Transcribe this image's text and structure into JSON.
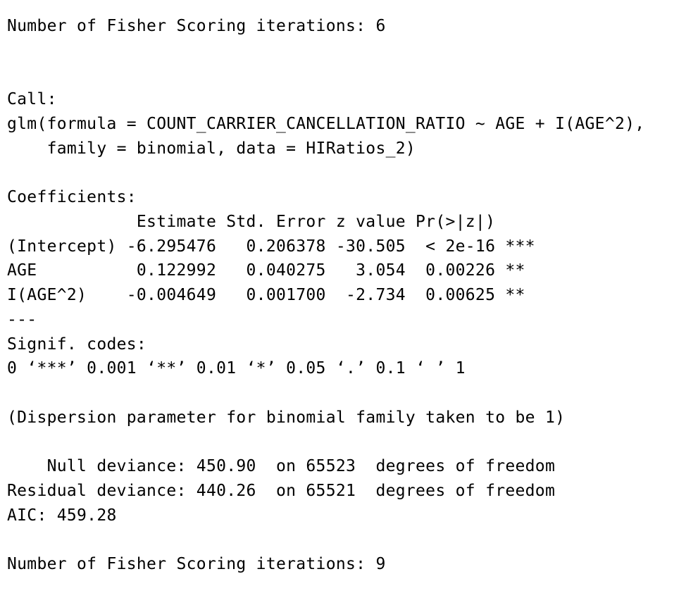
{
  "console": {
    "lines": [
      "Number of Fisher Scoring iterations: 6",
      "Call:",
      "glm(formula = COUNT_CARRIER_CANCELLATION_RATIO ~ AGE + I(AGE^2),",
      "    family = binomial, data = HIRatios_2)",
      "Coefficients:",
      "             Estimate Std. Error z value Pr(>|z|)    ",
      "(Intercept) -6.295476   0.206378 -30.505  < 2e-16 ***",
      "AGE          0.122992   0.040275   3.054  0.00226 ** ",
      "I(AGE^2)    -0.004649   0.001700  -2.734  0.00625 ** ",
      "---",
      "Signif. codes:",
      "0 ‘***’ 0.001 ‘**’ 0.01 ‘*’ 0.05 ‘.’ 0.1 ‘ ’ 1",
      "(Dispersion parameter for binomial family taken to be 1)",
      "    Null deviance: 450.90  on 65523  degrees of freedom",
      "Residual deviance: 440.26  on 65521  degrees of freedom",
      "AIC: 459.28",
      "Number of Fisher Scoring iterations: 9"
    ]
  }
}
